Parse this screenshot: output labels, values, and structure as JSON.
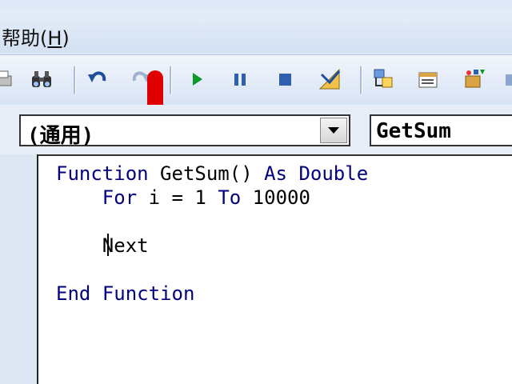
{
  "menu": {
    "help_label": "帮助(",
    "help_key": "H",
    "help_close": ")"
  },
  "toolbar": {
    "icons": [
      "print-icon",
      "find-icon",
      "undo-icon",
      "redo-icon",
      "run-icon",
      "pause-icon",
      "stop-icon",
      "design-mode-icon",
      "project-explorer-icon",
      "properties-icon",
      "object-browser-icon",
      "toolbox-icon"
    ]
  },
  "editor": {
    "object_combo": "(通用)",
    "procedure_combo": "GetSum",
    "code": [
      {
        "kw1": "Function",
        "rest1": " GetSum() ",
        "kw2": "As",
        "sp": " ",
        "kw3": "Double"
      },
      {
        "indent": "    ",
        "kw1": "For",
        "rest1": " i = 1 ",
        "kw2": "To",
        "rest2": " 10000"
      },
      {
        "indent": "    ",
        "kw1": "Next"
      },
      {
        "kw1": "End",
        "sp": " ",
        "kw2": "Function"
      }
    ]
  }
}
